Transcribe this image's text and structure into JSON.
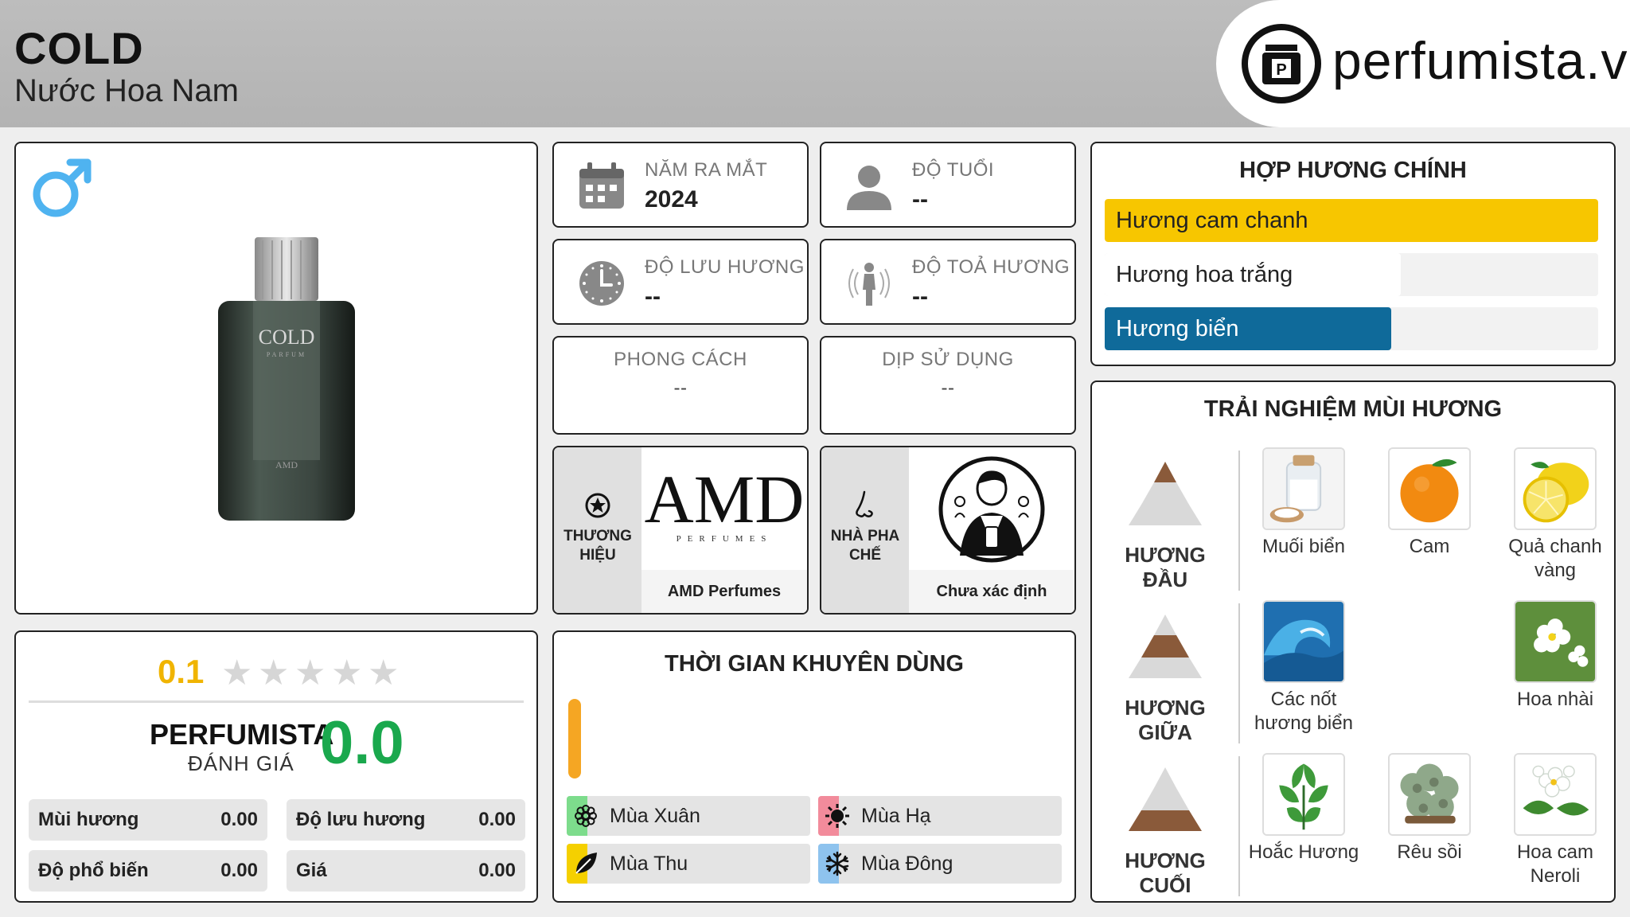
{
  "header": {
    "title": "COLD",
    "subtitle": "Nước Hoa Nam",
    "logo_text": "perfumista.vn"
  },
  "product": {
    "gender_icon": "male-symbol-icon",
    "bottle_label": "COLD",
    "bottle_sublabel": "PARFUM"
  },
  "info": {
    "launch_year": {
      "label": "NĂM RA MẮT",
      "value": "2024",
      "icon": "calendar-icon"
    },
    "age": {
      "label": "ĐỘ TUỔI",
      "value": "--",
      "icon": "person-icon"
    },
    "longevity": {
      "label": "ĐỘ LƯU HƯƠNG",
      "value": "--",
      "icon": "clock-icon"
    },
    "sillage": {
      "label": "ĐỘ TOẢ HƯƠNG",
      "value": "--",
      "icon": "aura-person-icon"
    },
    "style": {
      "label": "PHONG CÁCH",
      "value": "--"
    },
    "occasion": {
      "label": "DỊP SỬ DỤNG",
      "value": "--"
    }
  },
  "brand": {
    "label": "THƯƠNG HIỆU",
    "name": "AMD Perfumes",
    "logo_text": "AMD",
    "logo_sub": "PERFUMES"
  },
  "perfumer": {
    "label": "NHÀ PHA CHẾ",
    "name": "Chưa xác định"
  },
  "accords": {
    "title": "HỢP HƯƠNG CHÍNH",
    "items": [
      {
        "label": "Hương cam chanh",
        "strength": 1.0,
        "color": "#f7c600"
      },
      {
        "label": "Hương hoa trắng",
        "strength": 0.6,
        "color": "#ffffff"
      },
      {
        "label": "Hương biển",
        "strength": 0.58,
        "color": "#0f6a9a"
      }
    ]
  },
  "experience": {
    "title": "TRẢI NGHIỆM MÙI HƯƠNG",
    "layers": [
      {
        "label": "HƯƠNG ĐẦU",
        "notes": [
          {
            "label": "Muối biển",
            "icon": "sea-salt-icon",
            "slot": 0
          },
          {
            "label": "Cam",
            "icon": "orange-icon",
            "slot": 1
          },
          {
            "label": "Quả chanh vàng",
            "icon": "lemon-icon",
            "slot": 2
          }
        ]
      },
      {
        "label": "HƯƠNG GIỮA",
        "notes": [
          {
            "label": "Các nốt hương biển",
            "icon": "wave-icon",
            "slot": 0
          },
          {
            "label": "Hoa nhài",
            "icon": "jasmine-icon",
            "slot": 2
          }
        ]
      },
      {
        "label": "HƯƠNG CUỐI",
        "notes": [
          {
            "label": "Hoắc Hương",
            "icon": "patchouli-icon",
            "slot": 0
          },
          {
            "label": "Rêu sồi",
            "icon": "oakmoss-icon",
            "slot": 1
          },
          {
            "label": "Hoa cam Neroli",
            "icon": "neroli-icon",
            "slot": 2
          }
        ]
      }
    ]
  },
  "rating": {
    "user_score": "0.1",
    "stars_filled": 0.02,
    "perfumista_label": "PERFUMISTA",
    "perfumista_sub": "ĐÁNH GIÁ",
    "perfumista_score": "0.0",
    "metrics": [
      {
        "label": "Mùi hương",
        "value": "0.00"
      },
      {
        "label": "Độ lưu hương",
        "value": "0.00"
      },
      {
        "label": "Độ phổ biến",
        "value": "0.00"
      },
      {
        "label": "Giá",
        "value": "0.00"
      }
    ]
  },
  "usage": {
    "title": "THỜI GIAN KHUYÊN DÙNG",
    "day_color": "#f5a623",
    "seasons": [
      {
        "label": "Mùa Xuân",
        "icon": "flower-icon",
        "color": "#7ddc8c"
      },
      {
        "label": "Mùa Hạ",
        "icon": "sun-icon",
        "color": "#f28b9b"
      },
      {
        "label": "Mùa Thu",
        "icon": "leaf-icon",
        "color": "#f5d000"
      },
      {
        "label": "Mùa Đông",
        "icon": "snowflake-icon",
        "color": "#8ec3ee"
      }
    ]
  }
}
